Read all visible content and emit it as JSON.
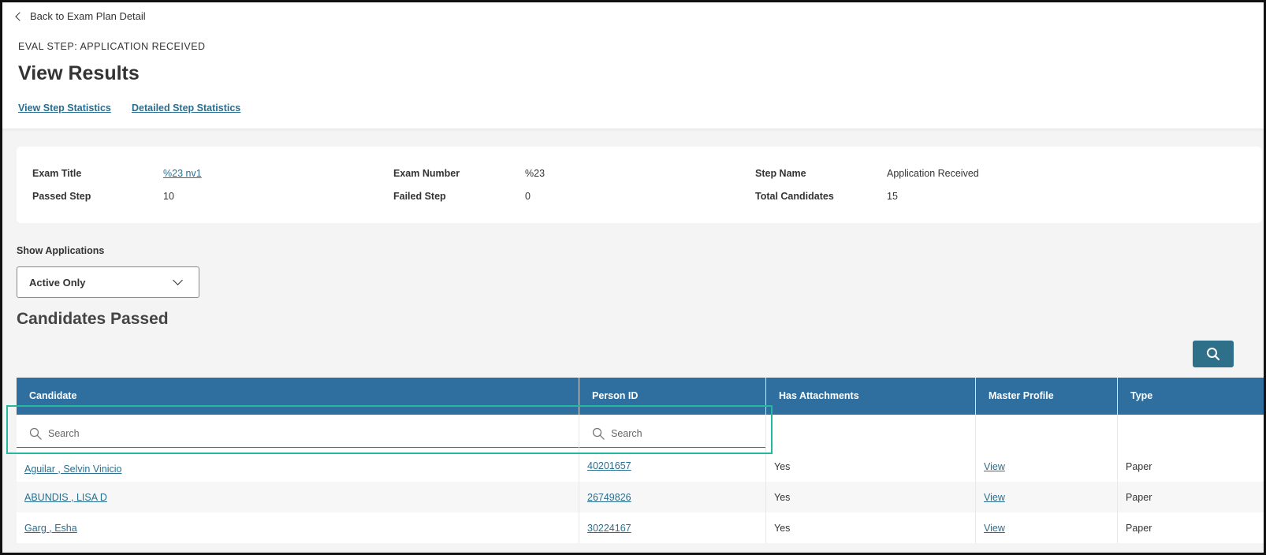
{
  "header": {
    "back_label": "Back to Exam Plan Detail",
    "eval_step": "EVAL STEP: APPLICATION RECEIVED",
    "title": "View Results",
    "links": [
      "View Step Statistics",
      "Detailed Step Statistics"
    ]
  },
  "summary": {
    "exam_title_label": "Exam Title",
    "exam_title_value": "%23 nv1",
    "exam_number_label": "Exam Number",
    "exam_number_value": "%23",
    "step_name_label": "Step Name",
    "step_name_value": "Application Received",
    "passed_label": "Passed Step",
    "passed_value": "10",
    "failed_label": "Failed Step",
    "failed_value": "0",
    "total_label": "Total Candidates",
    "total_value": "15"
  },
  "filter": {
    "label": "Show Applications",
    "selected": "Active Only"
  },
  "section_title": "Candidates Passed",
  "table": {
    "columns": [
      "Candidate",
      "Person ID",
      "Has Attachments",
      "Master Profile",
      "Type"
    ],
    "search_placeholder": "Search",
    "rows": [
      {
        "candidate": "Aguilar , Selvin Vinicio",
        "person_id": "40201657",
        "attachments": "Yes",
        "profile": "View",
        "type": "Paper"
      },
      {
        "candidate": "ABUNDIS , LISA D",
        "person_id": "26749826",
        "attachments": "Yes",
        "profile": "View",
        "type": "Paper"
      },
      {
        "candidate": "Garg , Esha",
        "person_id": "30224167",
        "attachments": "Yes",
        "profile": "View",
        "type": "Paper"
      }
    ]
  },
  "colors": {
    "header_bg": "#2f6f9f",
    "link": "#2a6e8f",
    "search_button": "#2e6f8a",
    "highlight": "#27b7a0"
  }
}
